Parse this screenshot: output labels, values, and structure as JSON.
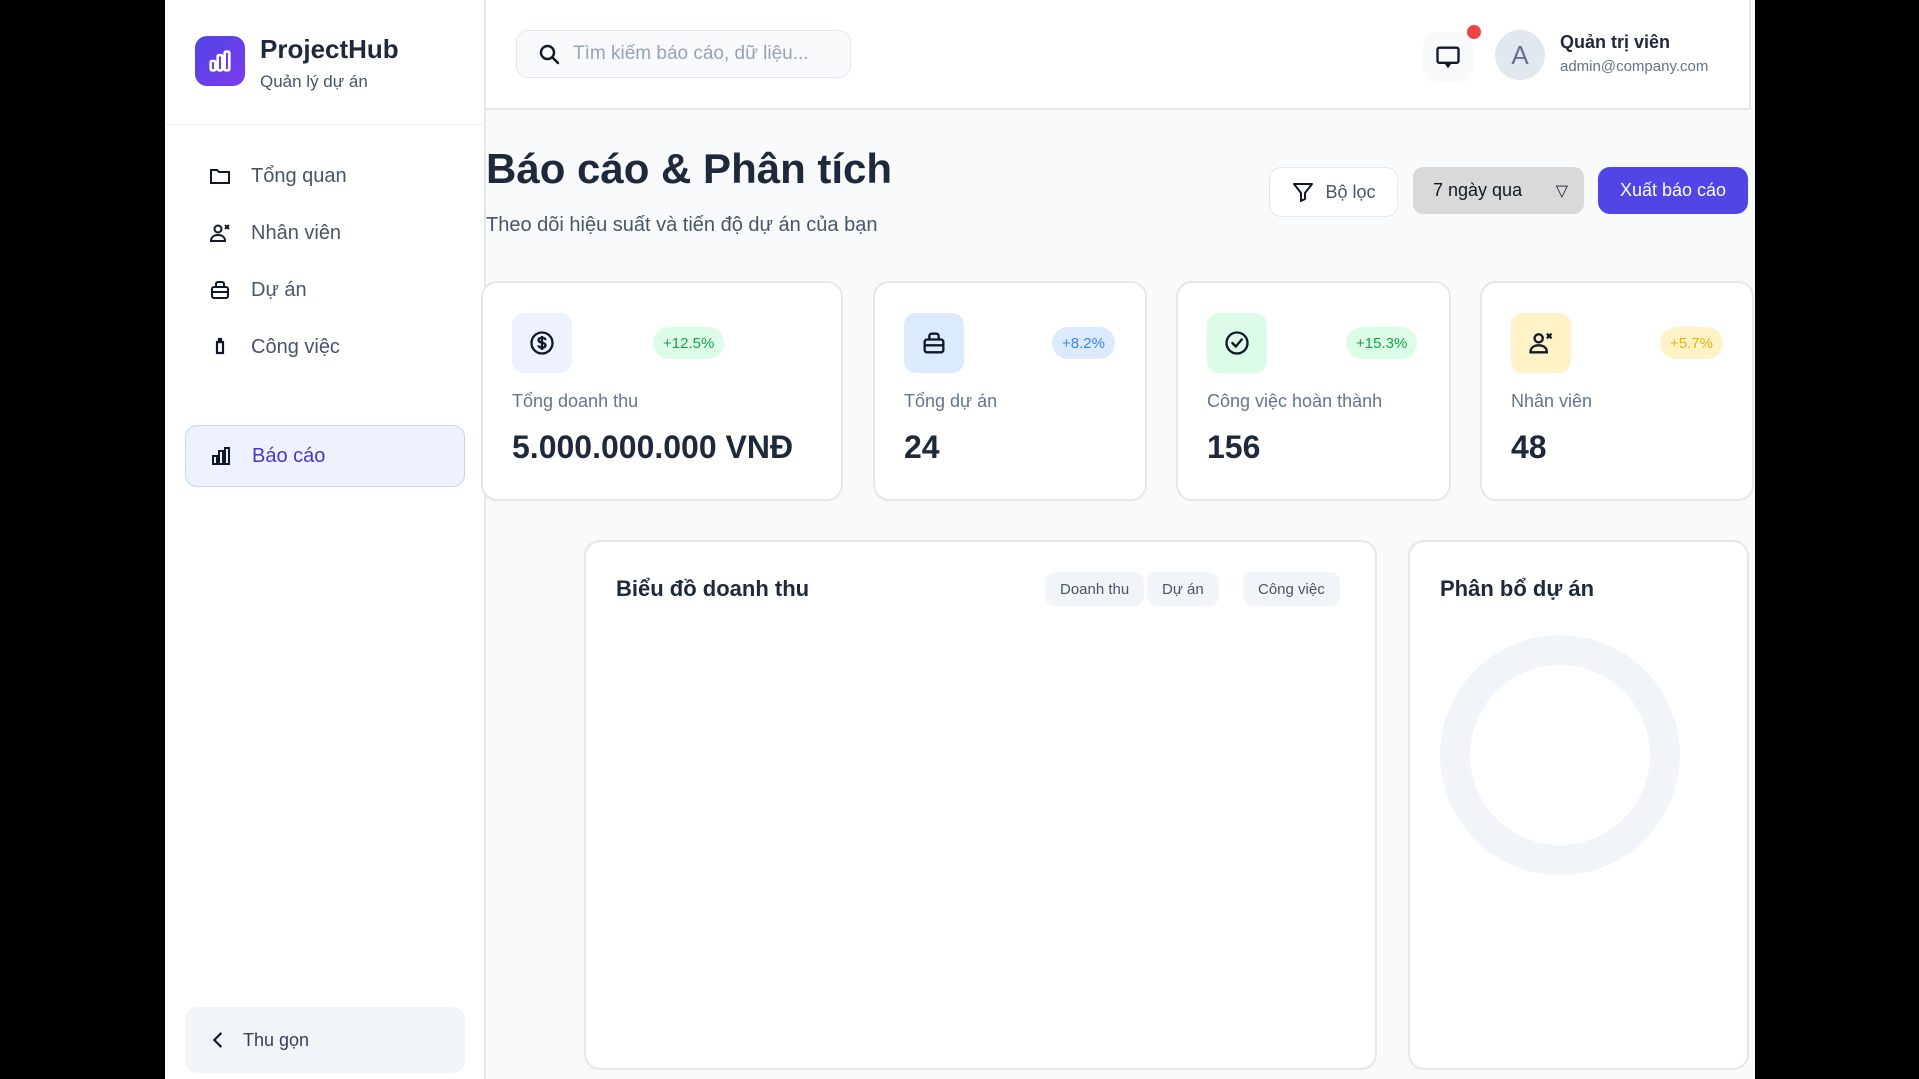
{
  "brand": {
    "name": "ProjectHub",
    "subtitle": "Quản lý dự án"
  },
  "sidebar": {
    "items": [
      {
        "label": "Tổng quan",
        "icon": "folder-icon"
      },
      {
        "label": "Nhân viên",
        "icon": "users-icon"
      },
      {
        "label": "Dự án",
        "icon": "briefcase-icon"
      },
      {
        "label": "Công việc",
        "icon": "task-icon"
      },
      {
        "label": "Báo cáo",
        "icon": "bar-chart-icon",
        "active": true
      }
    ],
    "collapse_label": "Thu gọn"
  },
  "header": {
    "search_placeholder": "Tìm kiếm báo cáo, dữ liệu...",
    "user_name": "Quản trị viên",
    "user_email": "admin@company.com",
    "avatar_initial": "A"
  },
  "page": {
    "title": "Báo cáo & Phân tích",
    "subtitle": "Theo dõi hiệu suất và tiến độ dự án của bạn",
    "filter_label": "Bộ lọc",
    "range_value": "7 ngày qua",
    "export_label": "Xuất báo cáo"
  },
  "stats": [
    {
      "label": "Tổng doanh thu",
      "value": "5.000.000.000 VNĐ",
      "change": "+12.5%",
      "icon": "dollar-icon",
      "color": "#16a34a"
    },
    {
      "label": "Tổng dự án",
      "value": "24",
      "change": "+8.2%",
      "icon": "briefcase-icon",
      "color": "#3b82f6"
    },
    {
      "label": "Công việc hoàn thành",
      "value": "156",
      "change": "+15.3%",
      "icon": "check-circle-icon",
      "color": "#16a34a"
    },
    {
      "label": "Nhân viên",
      "value": "48",
      "change": "+5.7%",
      "icon": "users-icon",
      "color": "#eab308"
    }
  ],
  "revenue_chart": {
    "title": "Biểu đồ doanh thu",
    "tabs": [
      "Doanh thu",
      "Dự án",
      "Công việc"
    ]
  },
  "distribution_chart": {
    "title": "Phân bổ dự án"
  }
}
